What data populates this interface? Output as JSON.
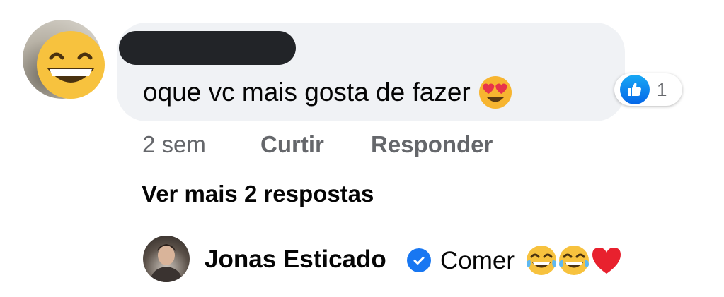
{
  "comment": {
    "text": "oque vc mais gosta de fazer",
    "author_redacted": true,
    "author_avatar_icon": "grinning-face-emoji-icon",
    "emoji_icon": "heart-eyes-emoji-icon",
    "reaction": {
      "icon": "like-icon",
      "count": "1"
    },
    "meta": {
      "time": "2 sem",
      "like_label": "Curtir",
      "reply_label": "Responder"
    }
  },
  "more_replies_label": "Ver mais 2 respostas",
  "reply": {
    "author_name": "Jonas Esticado",
    "verified_icon": "verified-badge-icon",
    "text": "Comer",
    "emojis": [
      "laughing-tears-emoji-icon",
      "laughing-tears-emoji-icon",
      "red-heart-emoji-icon"
    ]
  },
  "colors": {
    "bubble": "#f0f2f5",
    "secondary_text": "#65676b",
    "primary_text": "#050505",
    "like_blue": "#0566e8",
    "verified_blue": "#1877f2"
  }
}
